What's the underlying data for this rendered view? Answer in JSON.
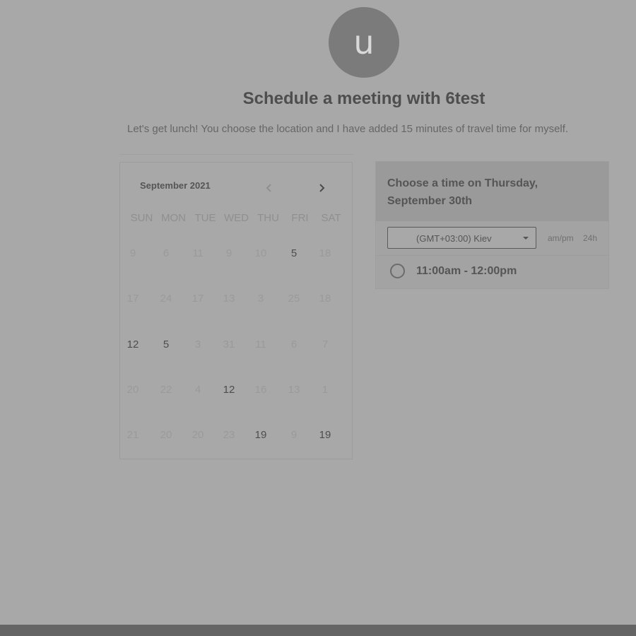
{
  "header": {
    "avatar_initial": "u",
    "title": "Schedule a meeting with 6test",
    "subtitle": "Let's get lunch! You choose the location and I have added 15 minutes of travel time for myself."
  },
  "calendar": {
    "month_label": "September 2021",
    "weekdays": [
      "SUN",
      "MON",
      "TUE",
      "WED",
      "THU",
      "FRI",
      "SAT"
    ],
    "weeks": [
      [
        {
          "label": "9",
          "available": false
        },
        {
          "label": "6",
          "available": false
        },
        {
          "label": "11",
          "available": false
        },
        {
          "label": "9",
          "available": false
        },
        {
          "label": "10",
          "available": false
        },
        {
          "label": "5",
          "available": true
        },
        {
          "label": "18",
          "available": false
        }
      ],
      [
        {
          "label": "17",
          "available": false
        },
        {
          "label": "24",
          "available": false
        },
        {
          "label": "17",
          "available": false
        },
        {
          "label": "13",
          "available": false
        },
        {
          "label": "3",
          "available": false
        },
        {
          "label": "25",
          "available": false
        },
        {
          "label": "18",
          "available": false
        }
      ],
      [
        {
          "label": "12",
          "available": true
        },
        {
          "label": "5",
          "available": true
        },
        {
          "label": "3",
          "available": false
        },
        {
          "label": "31",
          "available": false
        },
        {
          "label": "11",
          "available": false
        },
        {
          "label": "6",
          "available": false
        },
        {
          "label": "7",
          "available": false
        }
      ],
      [
        {
          "label": "20",
          "available": false
        },
        {
          "label": "22",
          "available": false
        },
        {
          "label": "4",
          "available": false
        },
        {
          "label": "12",
          "available": true
        },
        {
          "label": "16",
          "available": false
        },
        {
          "label": "13",
          "available": false
        },
        {
          "label": "1",
          "available": false
        }
      ],
      [
        {
          "label": "21",
          "available": false
        },
        {
          "label": "20",
          "available": false
        },
        {
          "label": "20",
          "available": false
        },
        {
          "label": "23",
          "available": false
        },
        {
          "label": "19",
          "available": true
        },
        {
          "label": "9",
          "available": false
        },
        {
          "label": "19",
          "available": true
        }
      ]
    ]
  },
  "timepanel": {
    "title": "Choose a time on Thursday, September 30th",
    "timezone": "(GMT+03:00) Kiev",
    "format_ampm": "am/pm",
    "format_24h": "24h",
    "slots": [
      "11:00am - 12:00pm"
    ]
  },
  "icons": {
    "prev": "chevron-left-icon",
    "next": "chevron-right-icon",
    "dropdown": "caret-down-icon",
    "radio": "radio-unchecked-icon"
  },
  "colors": {
    "background": "#a8a8a8",
    "avatar": "#7b7b7b",
    "text_primary": "#4e4e4e",
    "text_muted": "#9a9a9a",
    "footer": "#656565"
  }
}
